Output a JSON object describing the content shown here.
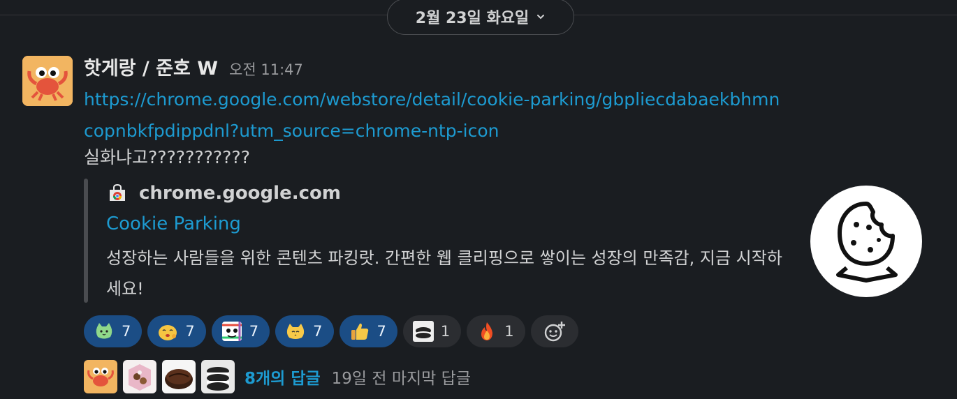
{
  "date_divider": {
    "label": "2월 23일 화요일"
  },
  "message": {
    "sender": "핫게랑 / 준호 W",
    "time": "오전 11:47",
    "link": "https://chrome.google.com/webstore/detail/cookie-parking/gbpliecdabaekbhmncopnbkfpdippdnl?utm_source=chrome-ntp-icon",
    "text": "실화냐고???????????"
  },
  "preview": {
    "site": "chrome.google.com",
    "title": "Cookie Parking",
    "description": "성장하는 사람들을 위한 콘텐츠 파킹랏. 간편한 웹 클리핑으로 쌓이는 성장의 만족감, 지금 시작하세요!"
  },
  "reactions": [
    {
      "emoji": "green-cat-emoji",
      "count": "7",
      "selected": true
    },
    {
      "emoji": "yellow-blob-emoji",
      "count": "7",
      "selected": true
    },
    {
      "emoji": "rainbow-face-emoji",
      "count": "7",
      "selected": true
    },
    {
      "emoji": "yellow-cat-emoji",
      "count": "7",
      "selected": true
    },
    {
      "emoji": "thumbs-up-emoji",
      "count": "7",
      "selected": true
    },
    {
      "emoji": "oreo-emoji",
      "count": "1",
      "selected": false
    },
    {
      "emoji": "fire-emoji",
      "count": "1",
      "selected": false
    }
  ],
  "thread": {
    "reply_count": "8개의 답글",
    "last_reply": "19일 전 마지막 답글"
  },
  "colors": {
    "background": "#1a1d21",
    "link": "#1d9bd1",
    "reaction_selected": "#1b4d85",
    "reaction_default": "#2b2d31"
  }
}
